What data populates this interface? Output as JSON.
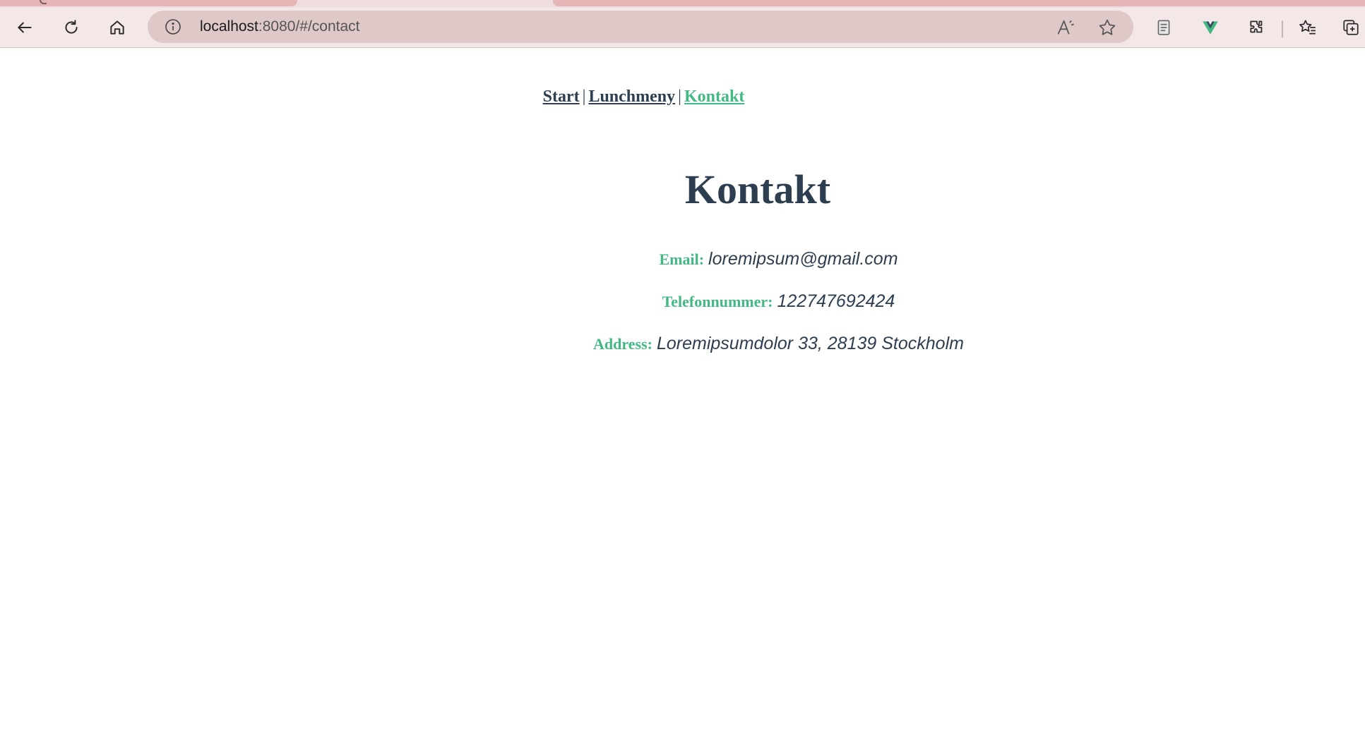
{
  "browser": {
    "address_host": "localhost",
    "address_rest": ":8080/#/contact",
    "icons": [
      "back-icon",
      "refresh-icon",
      "home-icon",
      "info-icon",
      "read-aloud-icon",
      "favorite-star-icon",
      "reading-view-icon",
      "vue-devtools-icon",
      "extensions-icon",
      "favorites-icon",
      "collections-icon"
    ],
    "accent_color": "#e6b6b6"
  },
  "nav": {
    "items": [
      {
        "label": "Start",
        "active": false
      },
      {
        "label": "Lunchmeny",
        "active": false
      },
      {
        "label": "Kontakt",
        "active": true
      }
    ],
    "separator": "|"
  },
  "page": {
    "title": "Kontakt",
    "contact": {
      "email_label": "Email:",
      "email_value": "loremipsum@gmail.com",
      "phone_label": "Telefonnummer:",
      "phone_value": "122747692424",
      "address_label": "Address:",
      "address_value": "Loremipsumdolor 33, 28139 Stockholm"
    }
  },
  "colors": {
    "text": "#2c3e50",
    "accent": "#42b983"
  }
}
